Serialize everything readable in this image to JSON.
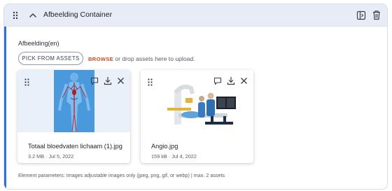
{
  "header": {
    "title": "Afbeelding Container",
    "icons": [
      "drag-handle-icon",
      "chevron-up-icon",
      "preview-icon",
      "trash-icon"
    ]
  },
  "field": {
    "label": "Afbeelding(en)",
    "pick_button": "PICK FROM ASSETS",
    "browse": "BROWSE",
    "hint": "or drop assets here to upload."
  },
  "assets": [
    {
      "name": "Totaal bloedvaten lichaam (1).jpg",
      "size": "3.2 MB",
      "date": "Jul 5, 2022",
      "meta": "3.2 MB · Jul 5, 2022",
      "thumb": "circulatory-system-image"
    },
    {
      "name": "Angio.jpg",
      "size": "159 kB",
      "date": "Jul 4, 2022",
      "meta": "159 kB · Jul 4, 2022",
      "thumb": "angiography-room-image"
    }
  ],
  "footnote": "Element parameters: Images adjustable images only (jpeg, png, gif, or webp) | max. 2 assets",
  "colors": {
    "header_bg": "#e8ecf6",
    "accent": "#2f6fe0",
    "browse": "#d24a1e"
  }
}
